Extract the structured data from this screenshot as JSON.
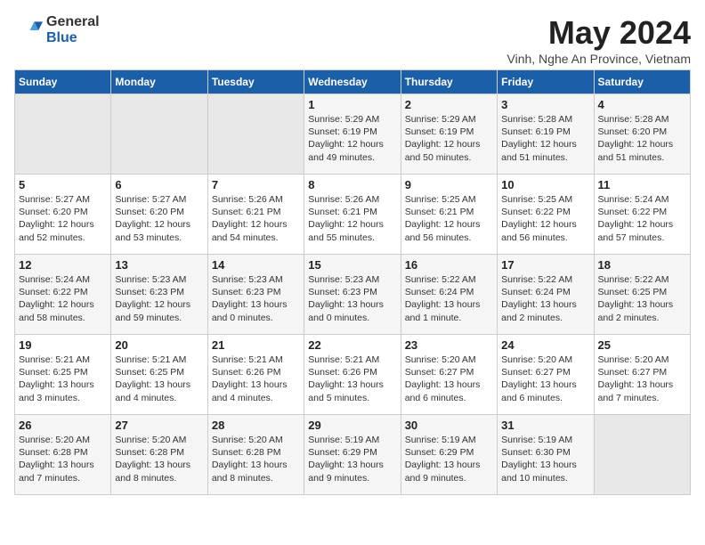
{
  "logo": {
    "general": "General",
    "blue": "Blue"
  },
  "title": "May 2024",
  "subtitle": "Vinh, Nghe An Province, Vietnam",
  "days_of_week": [
    "Sunday",
    "Monday",
    "Tuesday",
    "Wednesday",
    "Thursday",
    "Friday",
    "Saturday"
  ],
  "weeks": [
    [
      {
        "day": "",
        "info": ""
      },
      {
        "day": "",
        "info": ""
      },
      {
        "day": "",
        "info": ""
      },
      {
        "day": "1",
        "info": "Sunrise: 5:29 AM\nSunset: 6:19 PM\nDaylight: 12 hours\nand 49 minutes."
      },
      {
        "day": "2",
        "info": "Sunrise: 5:29 AM\nSunset: 6:19 PM\nDaylight: 12 hours\nand 50 minutes."
      },
      {
        "day": "3",
        "info": "Sunrise: 5:28 AM\nSunset: 6:19 PM\nDaylight: 12 hours\nand 51 minutes."
      },
      {
        "day": "4",
        "info": "Sunrise: 5:28 AM\nSunset: 6:20 PM\nDaylight: 12 hours\nand 51 minutes."
      }
    ],
    [
      {
        "day": "5",
        "info": "Sunrise: 5:27 AM\nSunset: 6:20 PM\nDaylight: 12 hours\nand 52 minutes."
      },
      {
        "day": "6",
        "info": "Sunrise: 5:27 AM\nSunset: 6:20 PM\nDaylight: 12 hours\nand 53 minutes."
      },
      {
        "day": "7",
        "info": "Sunrise: 5:26 AM\nSunset: 6:21 PM\nDaylight: 12 hours\nand 54 minutes."
      },
      {
        "day": "8",
        "info": "Sunrise: 5:26 AM\nSunset: 6:21 PM\nDaylight: 12 hours\nand 55 minutes."
      },
      {
        "day": "9",
        "info": "Sunrise: 5:25 AM\nSunset: 6:21 PM\nDaylight: 12 hours\nand 56 minutes."
      },
      {
        "day": "10",
        "info": "Sunrise: 5:25 AM\nSunset: 6:22 PM\nDaylight: 12 hours\nand 56 minutes."
      },
      {
        "day": "11",
        "info": "Sunrise: 5:24 AM\nSunset: 6:22 PM\nDaylight: 12 hours\nand 57 minutes."
      }
    ],
    [
      {
        "day": "12",
        "info": "Sunrise: 5:24 AM\nSunset: 6:22 PM\nDaylight: 12 hours\nand 58 minutes."
      },
      {
        "day": "13",
        "info": "Sunrise: 5:23 AM\nSunset: 6:23 PM\nDaylight: 12 hours\nand 59 minutes."
      },
      {
        "day": "14",
        "info": "Sunrise: 5:23 AM\nSunset: 6:23 PM\nDaylight: 13 hours\nand 0 minutes."
      },
      {
        "day": "15",
        "info": "Sunrise: 5:23 AM\nSunset: 6:23 PM\nDaylight: 13 hours\nand 0 minutes."
      },
      {
        "day": "16",
        "info": "Sunrise: 5:22 AM\nSunset: 6:24 PM\nDaylight: 13 hours\nand 1 minute."
      },
      {
        "day": "17",
        "info": "Sunrise: 5:22 AM\nSunset: 6:24 PM\nDaylight: 13 hours\nand 2 minutes."
      },
      {
        "day": "18",
        "info": "Sunrise: 5:22 AM\nSunset: 6:25 PM\nDaylight: 13 hours\nand 2 minutes."
      }
    ],
    [
      {
        "day": "19",
        "info": "Sunrise: 5:21 AM\nSunset: 6:25 PM\nDaylight: 13 hours\nand 3 minutes."
      },
      {
        "day": "20",
        "info": "Sunrise: 5:21 AM\nSunset: 6:25 PM\nDaylight: 13 hours\nand 4 minutes."
      },
      {
        "day": "21",
        "info": "Sunrise: 5:21 AM\nSunset: 6:26 PM\nDaylight: 13 hours\nand 4 minutes."
      },
      {
        "day": "22",
        "info": "Sunrise: 5:21 AM\nSunset: 6:26 PM\nDaylight: 13 hours\nand 5 minutes."
      },
      {
        "day": "23",
        "info": "Sunrise: 5:20 AM\nSunset: 6:27 PM\nDaylight: 13 hours\nand 6 minutes."
      },
      {
        "day": "24",
        "info": "Sunrise: 5:20 AM\nSunset: 6:27 PM\nDaylight: 13 hours\nand 6 minutes."
      },
      {
        "day": "25",
        "info": "Sunrise: 5:20 AM\nSunset: 6:27 PM\nDaylight: 13 hours\nand 7 minutes."
      }
    ],
    [
      {
        "day": "26",
        "info": "Sunrise: 5:20 AM\nSunset: 6:28 PM\nDaylight: 13 hours\nand 7 minutes."
      },
      {
        "day": "27",
        "info": "Sunrise: 5:20 AM\nSunset: 6:28 PM\nDaylight: 13 hours\nand 8 minutes."
      },
      {
        "day": "28",
        "info": "Sunrise: 5:20 AM\nSunset: 6:28 PM\nDaylight: 13 hours\nand 8 minutes."
      },
      {
        "day": "29",
        "info": "Sunrise: 5:19 AM\nSunset: 6:29 PM\nDaylight: 13 hours\nand 9 minutes."
      },
      {
        "day": "30",
        "info": "Sunrise: 5:19 AM\nSunset: 6:29 PM\nDaylight: 13 hours\nand 9 minutes."
      },
      {
        "day": "31",
        "info": "Sunrise: 5:19 AM\nSunset: 6:30 PM\nDaylight: 13 hours\nand 10 minutes."
      },
      {
        "day": "",
        "info": ""
      }
    ]
  ]
}
